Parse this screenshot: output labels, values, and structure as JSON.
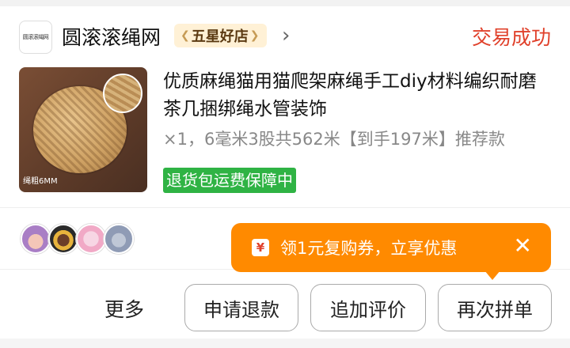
{
  "store": {
    "logo_text": "圆滚滚绳网",
    "name": "圆滚滚绳网",
    "badge_label": "五星好店",
    "status": "交易成功"
  },
  "product": {
    "image_caption": "绳粗6MM",
    "title": "优质麻绳猫用猫爬架麻绳手工diy材料编织耐磨茶几捆绑绳水管装饰",
    "spec": "×1，6毫米3股共562米【到手197米】推荐款",
    "return_tag": "退货包运费保障中"
  },
  "coupon": {
    "icon": "¥",
    "text": "领1元复购券，立享优惠",
    "close": "✕"
  },
  "actions": {
    "more": "更多",
    "refund": "申请退款",
    "review": "追加评价",
    "reorder": "再次拼单"
  },
  "colors": {
    "status": "#e0412b",
    "return_tag": "#2fb344",
    "coupon": "#ff8a00",
    "badge_bg": "#fff1d6"
  }
}
